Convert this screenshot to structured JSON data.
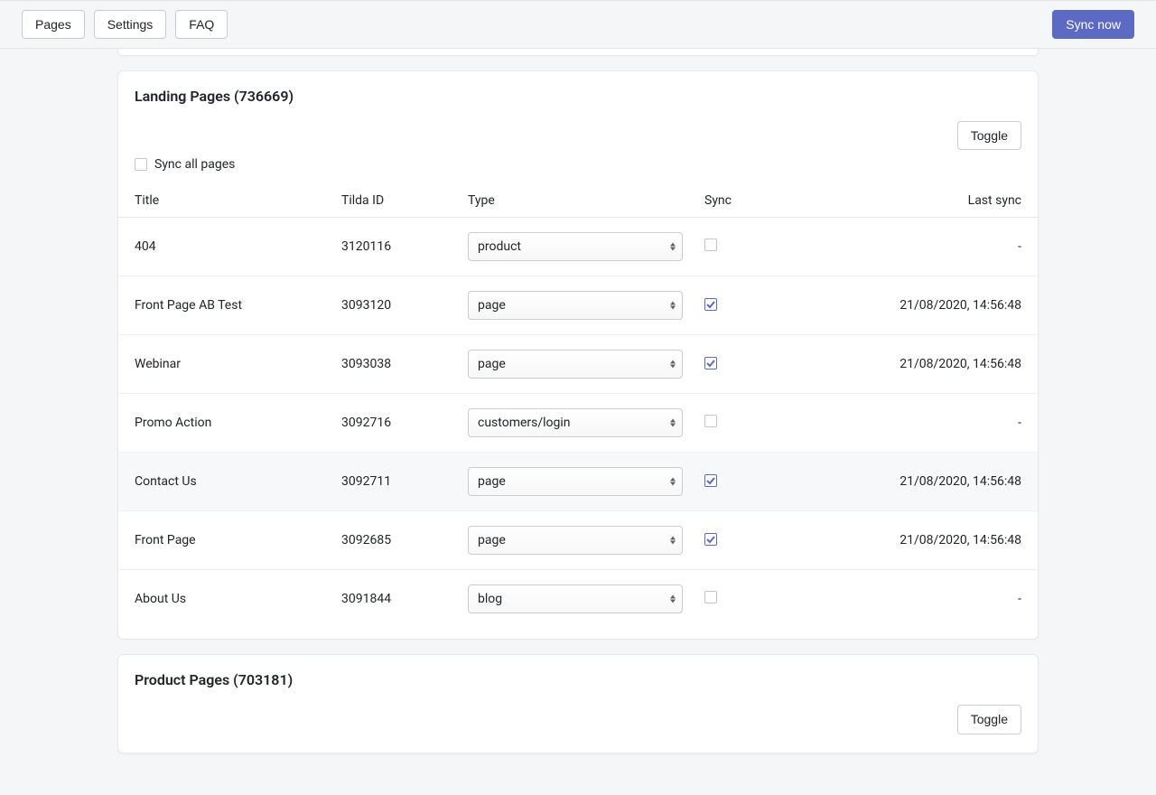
{
  "nav": {
    "pages": "Pages",
    "settings": "Settings",
    "faq": "FAQ",
    "sync_now": "Sync now"
  },
  "section1": {
    "title": "Landing Pages (736669)",
    "toggle": "Toggle",
    "sync_all": "Sync all pages"
  },
  "columns": {
    "title": "Title",
    "tilda_id": "Tilda ID",
    "type": "Type",
    "sync": "Sync",
    "last_sync": "Last sync"
  },
  "rows": [
    {
      "title": "404",
      "tilda": "3120116",
      "type": "product",
      "sync": false,
      "last": "-"
    },
    {
      "title": "Front Page AB Test",
      "tilda": "3093120",
      "type": "page",
      "sync": true,
      "last": "21/08/2020, 14:56:48"
    },
    {
      "title": "Webinar",
      "tilda": "3093038",
      "type": "page",
      "sync": true,
      "last": "21/08/2020, 14:56:48"
    },
    {
      "title": "Promo Action",
      "tilda": "3092716",
      "type": "customers/login",
      "sync": false,
      "last": "-"
    },
    {
      "title": "Contact Us",
      "tilda": "3092711",
      "type": "page",
      "sync": true,
      "last": "21/08/2020, 14:56:48",
      "hovered": true
    },
    {
      "title": "Front Page",
      "tilda": "3092685",
      "type": "page",
      "sync": true,
      "last": "21/08/2020, 14:56:48"
    },
    {
      "title": "About Us",
      "tilda": "3091844",
      "type": "blog",
      "sync": false,
      "last": "-"
    }
  ],
  "section2": {
    "title": "Product Pages (703181)",
    "toggle": "Toggle"
  }
}
